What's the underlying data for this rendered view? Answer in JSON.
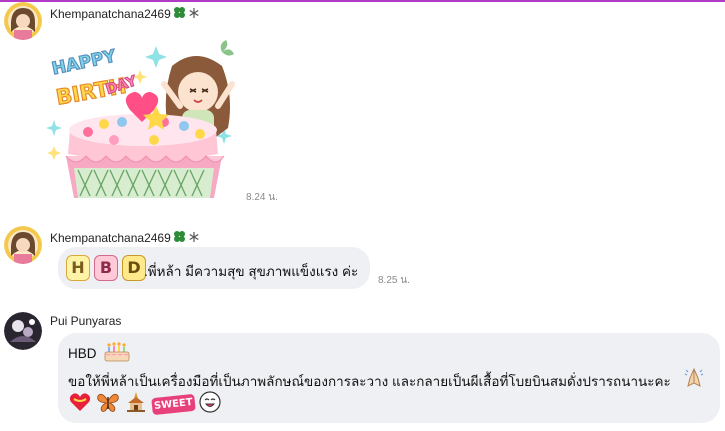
{
  "messages": [
    {
      "sender": "Khempanatchana2469",
      "type": "sticker",
      "sticker_text": [
        "HAPPY",
        "BIRTH",
        "DAY"
      ],
      "time": "8.24 น."
    },
    {
      "sender": "Khempanatchana2469",
      "type": "text",
      "hbd_letters": [
        "H",
        "B",
        "D"
      ],
      "text": ".พี่หล้า มีความสุข สุขภาพแข็งแรง ค่ะ",
      "time": "8.25 น."
    },
    {
      "sender": "Pui Punyaras",
      "type": "text",
      "line1": "HBD",
      "line2": "ขอให้พี่หล้าเป็นเครื่องมือที่เป็นภาพลักษณ์ของการละวาง และกลายเป็นผีเสื้อที่โบยบินสมดั่งปรารถนานะคะ",
      "sweet_label": "SWEET"
    }
  ],
  "colors": {
    "accent_line": "#b13ac6",
    "bubble": "#eef0f3",
    "time": "#8a8a8a",
    "clover": "#2e8b3a"
  }
}
